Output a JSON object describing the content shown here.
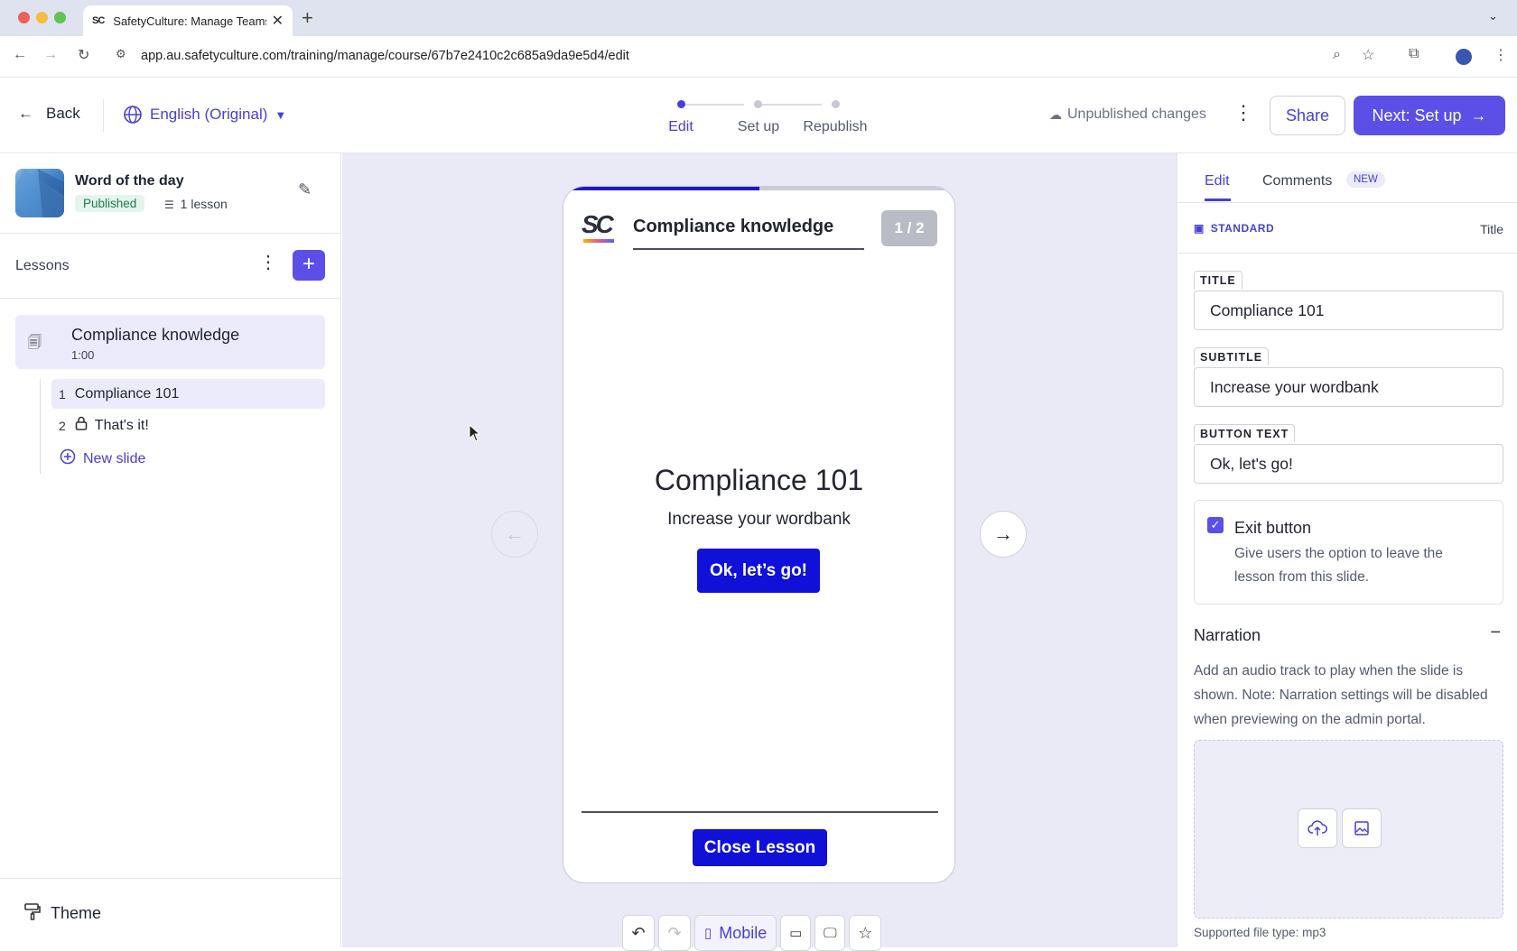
{
  "browser": {
    "tab_title": "SafetyCulture: Manage Teams",
    "favicon_text": "SC",
    "url": "app.au.safetyculture.com/training/manage/course/67b7e2410c2c685a9da9e5d4/edit"
  },
  "header": {
    "back_label": "Back",
    "language_label": "English (Original)",
    "steps": [
      {
        "label": "Edit",
        "active": true
      },
      {
        "label": "Set up",
        "active": false
      },
      {
        "label": "Republish",
        "active": false
      }
    ],
    "status_text": "Unpublished changes",
    "share_label": "Share",
    "next_label": "Next: Set up"
  },
  "sidebar": {
    "course_name": "Word of the day",
    "status_badge": "Published",
    "lesson_count": "1 lesson",
    "lessons_title": "Lessons",
    "lesson": {
      "name": "Compliance knowledge",
      "duration": "1:00"
    },
    "slides": [
      {
        "num": "1",
        "label": "Compliance 101",
        "locked": false,
        "selected": true
      },
      {
        "num": "2",
        "label": "That's it!",
        "locked": true,
        "selected": false
      }
    ],
    "new_slide_label": "New slide",
    "theme_label": "Theme"
  },
  "preview": {
    "progress": 0.5,
    "logo_text": "SC",
    "header_title": "Compliance knowledge",
    "counter": "1 / 2",
    "slide_title": "Compliance 101",
    "slide_subtitle": "Increase your wordbank",
    "slide_button": "Ok, let’s go!",
    "close_label": "Close Lesson",
    "device_label": "Mobile"
  },
  "right_panel": {
    "tab_edit": "Edit",
    "tab_comments": "Comments",
    "new_badge": "NEW",
    "layout_label": "STANDARD",
    "layout_type": "Title",
    "fields": {
      "title_label": "TITLE",
      "title_value": "Compliance 101",
      "subtitle_label": "SUBTITLE",
      "subtitle_value": "Increase your wordbank",
      "button_label": "BUTTON TEXT",
      "button_value": "Ok, let's go!"
    },
    "exit": {
      "checked": true,
      "title": "Exit button",
      "description": "Give users the option to leave the lesson from this slide."
    },
    "narration": {
      "title": "Narration",
      "description": "Add an audio track to play when the slide is shown. Note: Narration settings will be disabled when previewing on the admin portal.",
      "file_type": "Supported file type: mp3"
    }
  },
  "colors": {
    "accent": "#5b4fe8",
    "accent_text": "#4740d4",
    "slide_button": "#1010d8",
    "canvas_bg": "#e9eaf5"
  }
}
